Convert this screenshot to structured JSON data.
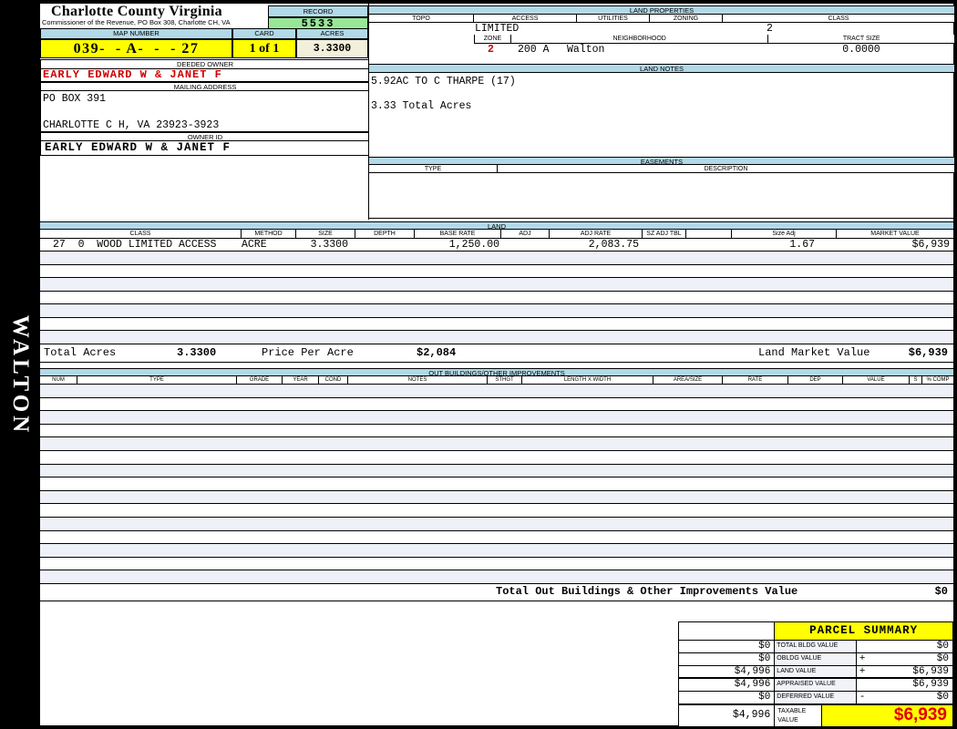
{
  "sidebar": {
    "label": "WALTON"
  },
  "header": {
    "county_title": "Charlotte County Virginia",
    "county_subtitle": "Commissioner of the Revenue, PO Box 308, Charlotte CH, VA",
    "record_label": "RECORD",
    "record_value": "5533",
    "map_number_label": "MAP NUMBER",
    "map_number_value": "039-  - A-  -  - 27",
    "card_label": "CARD",
    "card_value": "1 of 1",
    "acres_label": "ACRES",
    "acres_value": "3.3300"
  },
  "owner": {
    "deeded_owner_label": "DEEDED OWNER",
    "deeded_owner": "EARLY EDWARD W & JANET F",
    "mailing_address_label": "MAILING ADDRESS",
    "address_line1": "PO BOX 391",
    "address_line2": "CHARLOTTE C H, VA 23923-3923",
    "owner_id_label": "OWNER ID",
    "owner_id": "EARLY EDWARD W & JANET F"
  },
  "land_properties": {
    "title": "LAND PROPERTIES",
    "headers": [
      "TOPO",
      "ACCESS",
      "UTILITIES",
      "ZONING",
      "CLASS"
    ],
    "access_value": "LIMITED",
    "class_value": "2",
    "zone_label": "ZONE",
    "zone_value": "2",
    "neighborhood_label": "NEIGHBORHOOD",
    "neighborhood_code": "200 A",
    "neighborhood_name": "Walton",
    "tract_size_label": "TRACT SIZE",
    "tract_size_value": "0.0000"
  },
  "land_notes": {
    "title": "LAND NOTES",
    "line1": "5.92AC TO C THARPE (17)",
    "line2": "3.33 Total Acres"
  },
  "easements": {
    "title": "EASEMENTS",
    "headers": [
      "TYPE",
      "DESCRIPTION"
    ]
  },
  "land": {
    "title": "LAND",
    "headers": [
      "CLASS",
      "METHOD",
      "SIZE",
      "DEPTH",
      "BASE RATE",
      "ADJ",
      "ADJ RATE",
      "SZ ADJ TBL",
      "",
      "Size Adj",
      "MARKET VALUE"
    ],
    "row": {
      "class": "27  0  WOOD LIMITED ACCESS",
      "method": "ACRE",
      "size": "3.3300",
      "base_rate": "1,250.00",
      "adj_rate": "2,083.75",
      "size_adj": "1.67",
      "market_value": "$6,939"
    },
    "total_acres_label": "Total Acres",
    "total_acres_value": "3.3300",
    "price_per_acre_label": "Price Per Acre",
    "price_per_acre_value": "$2,084",
    "land_market_value_label": "Land Market Value",
    "land_market_value": "$6,939"
  },
  "out_buildings": {
    "title": "OUT BUILDINGS/OTHER IMPROVEMENTS",
    "headers": [
      "NUM",
      "TYPE",
      "GRADE",
      "YEAR",
      "COND",
      "NOTES",
      "STHGT",
      "LENGTH X WIDTH",
      "AREA/SIZE",
      "RATE",
      "DEP",
      "VALUE",
      "S",
      "% COMP"
    ],
    "total_label": "Total Out Buildings & Other Improvements Value",
    "total_value": "$0"
  },
  "parcel_summary": {
    "title": "PARCEL SUMMARY",
    "rows": [
      {
        "left": "$0",
        "label": "TOTAL BLDG VALUE",
        "sign": "",
        "value": "$0"
      },
      {
        "left": "$0",
        "label": "OBLDG VALUE",
        "sign": "+",
        "value": "$0"
      },
      {
        "left": "$4,996",
        "label": "LAND VALUE",
        "sign": "+",
        "value": "$6,939"
      },
      {
        "left": "$4,996",
        "label": "APPRAISED VALUE",
        "sign": "",
        "value": "$6,939"
      },
      {
        "left": "$0",
        "label": "DEFERRED VALUE",
        "sign": "-",
        "value": "$0"
      }
    ],
    "taxable": {
      "left": "$4,996",
      "label": "TAXABLE VALUE",
      "value": "$6,939"
    }
  },
  "colors": {
    "section_bar": "#b2d9e8",
    "record_green": "#98e698",
    "highlight_yellow": "#ffff00",
    "acres_cream": "#f2efda",
    "stripe": "#eef1f8",
    "alert_red": "#cc0000"
  }
}
